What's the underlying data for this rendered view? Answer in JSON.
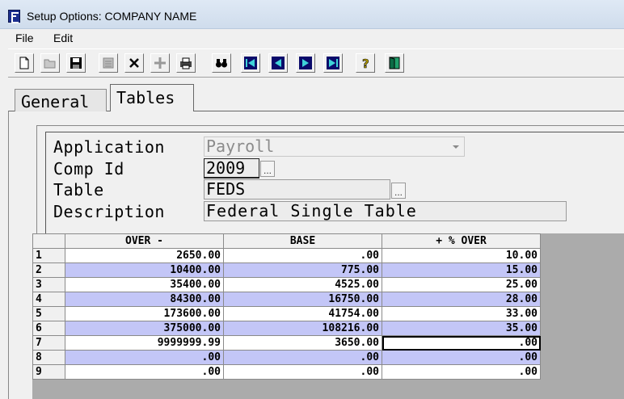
{
  "window": {
    "title": "Setup Options: COMPANY NAME"
  },
  "menu": {
    "file": "File",
    "edit": "Edit"
  },
  "toolbar": {
    "buttons": [
      {
        "icon": "new-document-icon"
      },
      {
        "icon": "open-folder-icon"
      },
      {
        "icon": "save-icon"
      },
      {
        "icon": "calculator-icon"
      },
      {
        "icon": "delete-x-icon"
      },
      {
        "icon": "add-plus-icon"
      },
      {
        "icon": "print-icon"
      },
      {
        "icon": "find-binoculars-icon"
      },
      {
        "icon": "first-record-icon"
      },
      {
        "icon": "previous-record-icon"
      },
      {
        "icon": "next-record-icon"
      },
      {
        "icon": "last-record-icon"
      },
      {
        "icon": "help-icon"
      },
      {
        "icon": "exit-door-icon"
      }
    ]
  },
  "tabs": {
    "general": "General",
    "tables": "Tables"
  },
  "form": {
    "application_label": "Application",
    "application_value": "Payroll",
    "comp_id_label": "Comp Id",
    "comp_id_value": "2009",
    "table_label": "Table",
    "table_value": "FEDS",
    "description_label": "Description",
    "description_value": "Federal Single Table",
    "ellipsis": "..."
  },
  "grid": {
    "headers": [
      "OVER -",
      "BASE",
      "+ % OVER"
    ],
    "rows": [
      {
        "n": "1",
        "over": "2650.00",
        "base": ".00",
        "pct": "10.00"
      },
      {
        "n": "2",
        "over": "10400.00",
        "base": "775.00",
        "pct": "15.00"
      },
      {
        "n": "3",
        "over": "35400.00",
        "base": "4525.00",
        "pct": "25.00"
      },
      {
        "n": "4",
        "over": "84300.00",
        "base": "16750.00",
        "pct": "28.00"
      },
      {
        "n": "5",
        "over": "173600.00",
        "base": "41754.00",
        "pct": "33.00"
      },
      {
        "n": "6",
        "over": "375000.00",
        "base": "108216.00",
        "pct": "35.00"
      },
      {
        "n": "7",
        "over": "9999999.99",
        "base": "3650.00",
        "pct": ".00"
      },
      {
        "n": "8",
        "over": ".00",
        "base": ".00",
        "pct": ".00"
      },
      {
        "n": "9",
        "over": ".00",
        "base": ".00",
        "pct": ".00"
      }
    ]
  },
  "colors": {
    "row_highlight": "#c3c6f7",
    "title_bar": "#dfe9f5",
    "app_icon": "#1c2f8f"
  }
}
